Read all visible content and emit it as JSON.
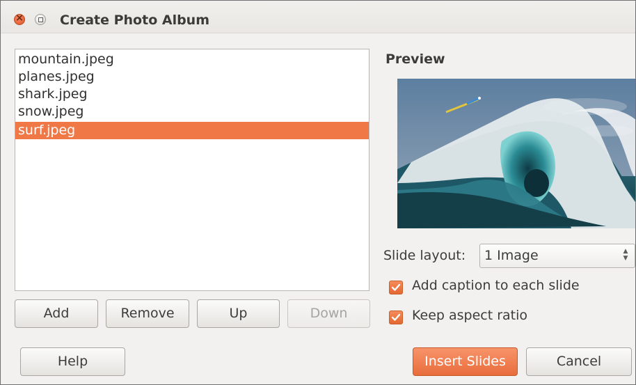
{
  "window": {
    "title": "Create Photo Album",
    "controls": [
      "close-icon",
      "maximize-icon"
    ]
  },
  "file_list": {
    "items": [
      {
        "name": "mountain.jpeg",
        "selected": false
      },
      {
        "name": "planes.jpeg",
        "selected": false
      },
      {
        "name": "shark.jpeg",
        "selected": false
      },
      {
        "name": "snow.jpeg",
        "selected": false
      },
      {
        "name": "surf.jpeg",
        "selected": true
      }
    ]
  },
  "list_buttons": {
    "add": "Add",
    "remove": "Remove",
    "up": "Up",
    "down": "Down",
    "down_disabled": true
  },
  "preview": {
    "label": "Preview",
    "image": "surf-wave-photo"
  },
  "slide_layout": {
    "label": "Slide layout:",
    "value": "1 Image"
  },
  "options": {
    "add_caption": {
      "label": "Add caption to each slide",
      "checked": true
    },
    "keep_aspect": {
      "label": "Keep aspect ratio",
      "checked": true
    }
  },
  "footer": {
    "help": "Help",
    "insert": "Insert Slides",
    "cancel": "Cancel"
  },
  "colors": {
    "accent": "#f07746",
    "window_bg": "#f2f1f0"
  }
}
